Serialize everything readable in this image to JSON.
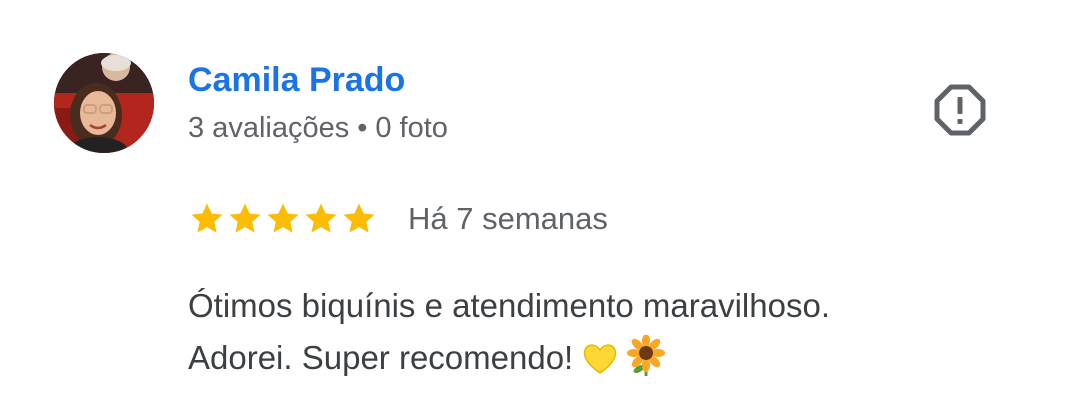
{
  "review": {
    "author": {
      "name": "Camila Prado",
      "review_count": "3 avaliações",
      "separator": "•",
      "photo_count": "0 foto",
      "avatar_icon": "user-avatar-photo"
    },
    "flag_icon": "report-octagon-icon",
    "rating": 5,
    "rating_max": 5,
    "date": "Há 7 semanas",
    "text_line_1": "Ótimos biquínis e atendimento maravilhoso.",
    "text_line_2": "Adorei. Super recomendo!",
    "emojis": [
      "yellow-heart-emoji",
      "sunflower-emoji"
    ]
  },
  "colors": {
    "name": "#1a73e8",
    "meta": "#5f6368",
    "star": "#fbbc04",
    "text": "#3c4043",
    "flag": "#5f6368"
  }
}
